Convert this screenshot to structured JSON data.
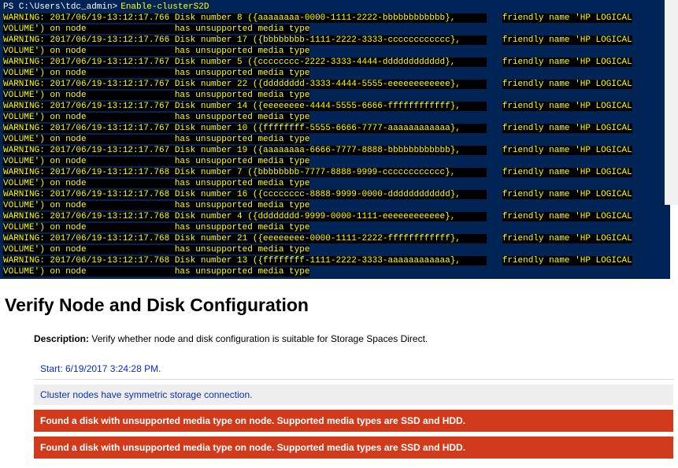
{
  "terminal": {
    "prompt_path": "PS C:\\Users\\tdc_admin>",
    "prompt_cmd": "Enable-clusterS2D",
    "entries": [
      {
        "num": "8",
        "ts": "2017/06/19-13:12:17.766",
        "guid": "{aaaaaaaa-0000-1111-2222-bbbbbbbbbbbb}"
      },
      {
        "num": "17",
        "ts": "2017/06/19-13:12:17.766",
        "guid": "{bbbbbbbb-1111-2222-3333-cccccccccccc}"
      },
      {
        "num": "5",
        "ts": "2017/06/19-13:12:17.767",
        "guid": "{cccccccc-2222-3333-4444-dddddddddddd}"
      },
      {
        "num": "22",
        "ts": "2017/06/19-13:12:17.767",
        "guid": "{dddddddd-3333-4444-5555-eeeeeeeeeeee}"
      },
      {
        "num": "14",
        "ts": "2017/06/19-13:12:17.767",
        "guid": "{eeeeeeee-4444-5555-6666-ffffffffffff}"
      },
      {
        "num": "10",
        "ts": "2017/06/19-13:12:17.767",
        "guid": "{ffffffff-5555-6666-7777-aaaaaaaaaaaa}"
      },
      {
        "num": "19",
        "ts": "2017/06/19-13:12:17.767",
        "guid": "{aaaaaaaa-6666-7777-8888-bbbbbbbbbbbb}"
      },
      {
        "num": "7",
        "ts": "2017/06/19-13:12:17.768",
        "guid": "{bbbbbbbb-7777-8888-9999-cccccccccccc}"
      },
      {
        "num": "16",
        "ts": "2017/06/19-13:12:17.768",
        "guid": "{cccccccc-8888-9999-0000-dddddddddddd}"
      },
      {
        "num": "4",
        "ts": "2017/06/19-13:12:17.768",
        "guid": "{dddddddd-9999-0000-1111-eeeeeeeeeeee}"
      },
      {
        "num": "21",
        "ts": "2017/06/19-13:12:17.768",
        "guid": "{eeeeeeee-0000-1111-2222-ffffffffffff}"
      },
      {
        "num": "13",
        "ts": "2017/06/19-13:12:17.768",
        "guid": "{ffffffff-1111-2222-3333-aaaaaaaaaaaa}"
      }
    ],
    "friendly": "friendly name 'HP LOGICAL",
    "volume_on_node": "VOLUME') on node",
    "unsupported": "has unsupported media type",
    "warn_prefix": "WARNING:",
    "disk_label": "Disk number"
  },
  "section": {
    "heading": "Verify Node and Disk Configuration",
    "desc_label": "Description:",
    "desc_text": "Verify whether node and disk configuration is suitable for Storage Spaces Direct.",
    "start": "Start: 6/19/2017 3:24:28 PM.",
    "conn": "Cluster nodes have symmetric storage connection.",
    "err": "Found a disk with unsupported media type on node. Supported media types are SSD and HDD."
  }
}
